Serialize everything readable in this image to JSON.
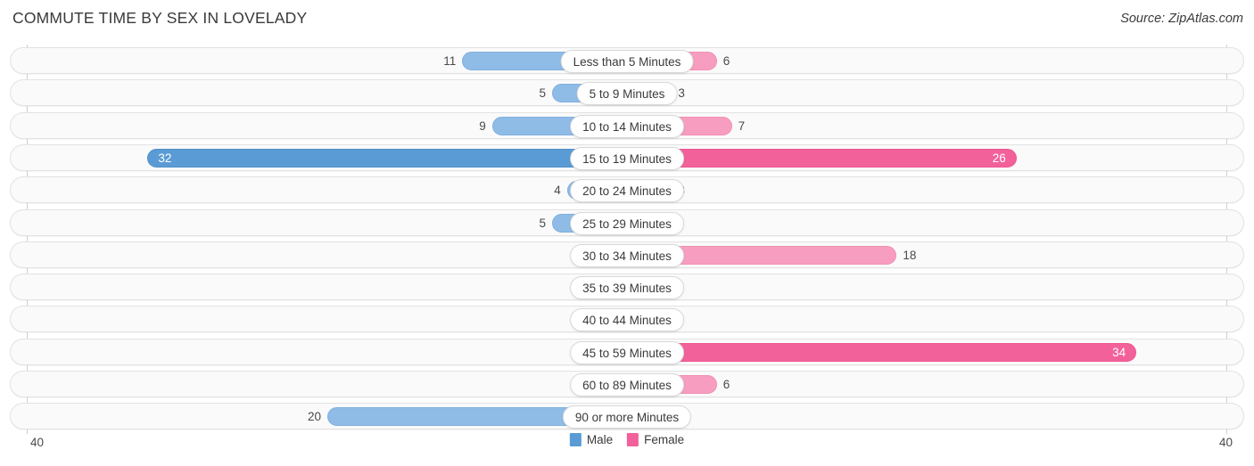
{
  "header": {
    "title": "COMMUTE TIME BY SEX IN LOVELADY",
    "source": "Source: ZipAtlas.com"
  },
  "legend": {
    "male_label": "Male",
    "female_label": "Female",
    "male_color": "#5b9bd5",
    "female_color": "#f2619a"
  },
  "axis": {
    "left_tick": "40",
    "right_tick": "40",
    "max": 40
  },
  "colors": {
    "male_normal": "#8fbce7",
    "male_highlight": "#5b9bd5",
    "female_normal": "#f79dbf",
    "female_highlight": "#f2619a",
    "row_background": "#fafafa",
    "row_border": "#e2e2e2"
  },
  "chart_data": {
    "type": "bar",
    "title": "COMMUTE TIME BY SEX IN LOVELADY",
    "subtitle": "Source: ZipAtlas.com",
    "orientation": "horizontal-diverging",
    "xlabel": "",
    "ylabel": "",
    "xlim": [
      -40,
      40
    ],
    "axis_tick_labels": [
      "40",
      "40"
    ],
    "grid": false,
    "legend_position": "bottom-center",
    "categories": [
      "Less than 5 Minutes",
      "5 to 9 Minutes",
      "10 to 14 Minutes",
      "15 to 19 Minutes",
      "20 to 24 Minutes",
      "25 to 29 Minutes",
      "30 to 34 Minutes",
      "35 to 39 Minutes",
      "40 to 44 Minutes",
      "45 to 59 Minutes",
      "60 to 89 Minutes",
      "90 or more Minutes"
    ],
    "series": [
      {
        "name": "Male",
        "values": [
          11,
          5,
          9,
          32,
          4,
          5,
          2,
          2,
          0,
          2,
          0,
          20
        ]
      },
      {
        "name": "Female",
        "values": [
          6,
          3,
          7,
          26,
          3,
          2,
          18,
          0,
          0,
          34,
          6,
          0
        ]
      }
    ],
    "highlighted_rows": [
      "15 to 19 Minutes",
      "45 to 59 Minutes"
    ]
  },
  "rows": [
    {
      "label": "Less than 5 Minutes",
      "male": "11",
      "female": "6",
      "male_hi": false,
      "female_hi": false
    },
    {
      "label": "5 to 9 Minutes",
      "male": "5",
      "female": "3",
      "male_hi": false,
      "female_hi": false
    },
    {
      "label": "10 to 14 Minutes",
      "male": "9",
      "female": "7",
      "male_hi": false,
      "female_hi": false
    },
    {
      "label": "15 to 19 Minutes",
      "male": "32",
      "female": "26",
      "male_hi": true,
      "female_hi": true
    },
    {
      "label": "20 to 24 Minutes",
      "male": "4",
      "female": "3",
      "male_hi": false,
      "female_hi": false
    },
    {
      "label": "25 to 29 Minutes",
      "male": "5",
      "female": "2",
      "male_hi": false,
      "female_hi": false
    },
    {
      "label": "30 to 34 Minutes",
      "male": "2",
      "female": "18",
      "male_hi": false,
      "female_hi": false
    },
    {
      "label": "35 to 39 Minutes",
      "male": "2",
      "female": "0",
      "male_hi": false,
      "female_hi": false
    },
    {
      "label": "40 to 44 Minutes",
      "male": "0",
      "female": "0",
      "male_hi": false,
      "female_hi": false
    },
    {
      "label": "45 to 59 Minutes",
      "male": "2",
      "female": "34",
      "male_hi": false,
      "female_hi": true
    },
    {
      "label": "60 to 89 Minutes",
      "male": "0",
      "female": "6",
      "male_hi": false,
      "female_hi": false
    },
    {
      "label": "90 or more Minutes",
      "male": "20",
      "female": "0",
      "male_hi": false,
      "female_hi": false
    }
  ]
}
